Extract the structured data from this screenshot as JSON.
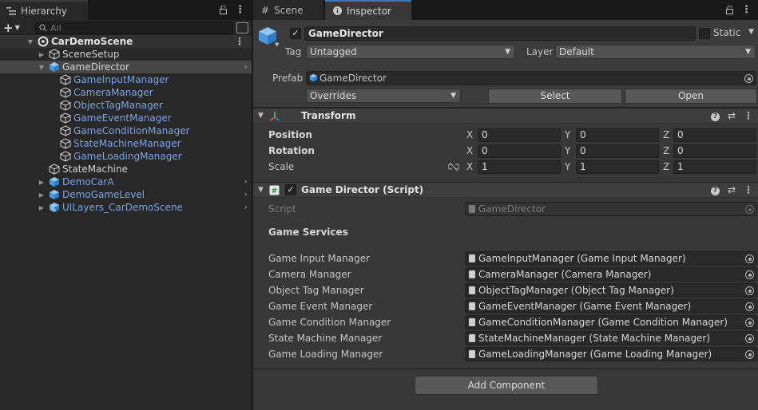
{
  "hierarchy": {
    "tab_label": "Hierarchy",
    "search": {
      "placeholder": "All",
      "value": ""
    },
    "scene_name": "CarDemoScene",
    "items": [
      {
        "label": "SceneSetup",
        "kind": "plain",
        "icon": "gameobject-icon"
      },
      {
        "label": "GameDirector",
        "kind": "plain",
        "icon": "prefab-cube-icon",
        "selected": true,
        "has_arrow": true
      },
      {
        "label": "GameInputManager",
        "kind": "prefab",
        "icon": "prefab-outline-icon"
      },
      {
        "label": "CameraManager",
        "kind": "prefab",
        "icon": "prefab-outline-icon"
      },
      {
        "label": "ObjectTagManager",
        "kind": "prefab",
        "icon": "prefab-outline-icon"
      },
      {
        "label": "GameEventManager",
        "kind": "prefab",
        "icon": "prefab-outline-icon"
      },
      {
        "label": "GameConditionManager",
        "kind": "prefab",
        "icon": "prefab-outline-icon"
      },
      {
        "label": "StateMachineManager",
        "kind": "prefab",
        "icon": "prefab-outline-icon"
      },
      {
        "label": "GameLoadingManager",
        "kind": "prefab",
        "icon": "prefab-outline-icon"
      },
      {
        "label": "StateMachine",
        "kind": "plain",
        "icon": "gameobject-icon"
      },
      {
        "label": "DemoCarA",
        "kind": "prefab",
        "icon": "prefab-cube-icon",
        "has_arrow": true
      },
      {
        "label": "DemoGameLevel",
        "kind": "prefab",
        "icon": "prefab-cube-icon",
        "has_arrow": true
      },
      {
        "label": "UILayers_CarDemoScene",
        "kind": "prefab",
        "icon": "prefab-variant-icon",
        "has_arrow": true
      }
    ]
  },
  "tabs": {
    "scene_label": "Scene",
    "inspector_label": "Inspector"
  },
  "gameobject": {
    "active": true,
    "name": "GameDirector",
    "static_label": "Static",
    "tag_label": "Tag",
    "tag_value": "Untagged",
    "layer_label": "Layer",
    "layer_value": "Default",
    "prefab_label": "Prefab",
    "prefab_asset": "GameDirector",
    "overrides_label": "Overrides",
    "select_label": "Select",
    "open_label": "Open"
  },
  "transform": {
    "title": "Transform",
    "rows": [
      {
        "label": "Position",
        "bold": true,
        "x": "0",
        "y": "0",
        "z": "0"
      },
      {
        "label": "Rotation",
        "bold": true,
        "x": "0",
        "y": "0",
        "z": "0"
      },
      {
        "label": "Scale",
        "bold": false,
        "x": "1",
        "y": "1",
        "z": "1"
      }
    ],
    "axis_labels": [
      "X",
      "Y",
      "Z"
    ]
  },
  "game_director": {
    "title": "Game Director (Script)",
    "script_label": "Script",
    "script_value": "GameDirector",
    "section_title": "Game Services",
    "fields": [
      {
        "label": "Game Input Manager",
        "value": "GameInputManager (Game Input Manager)"
      },
      {
        "label": "Camera Manager",
        "value": "CameraManager (Camera Manager)"
      },
      {
        "label": "Object Tag Manager",
        "value": "ObjectTagManager (Object Tag Manager)"
      },
      {
        "label": "Game Event Manager",
        "value": "GameEventManager (Game Event Manager)"
      },
      {
        "label": "Game Condition Manager",
        "value": "GameConditionManager (Game Condition Manager)"
      },
      {
        "label": "State Machine Manager",
        "value": "StateMachineManager (State Machine Manager)"
      },
      {
        "label": "Game Loading Manager",
        "value": "GameLoadingManager (Game Loading Manager)"
      }
    ]
  },
  "add_component_label": "Add Component",
  "colors": {
    "prefab_text": "#7ba3e6",
    "selection": "#474747",
    "active_tab_accent": "#3a79bb"
  }
}
